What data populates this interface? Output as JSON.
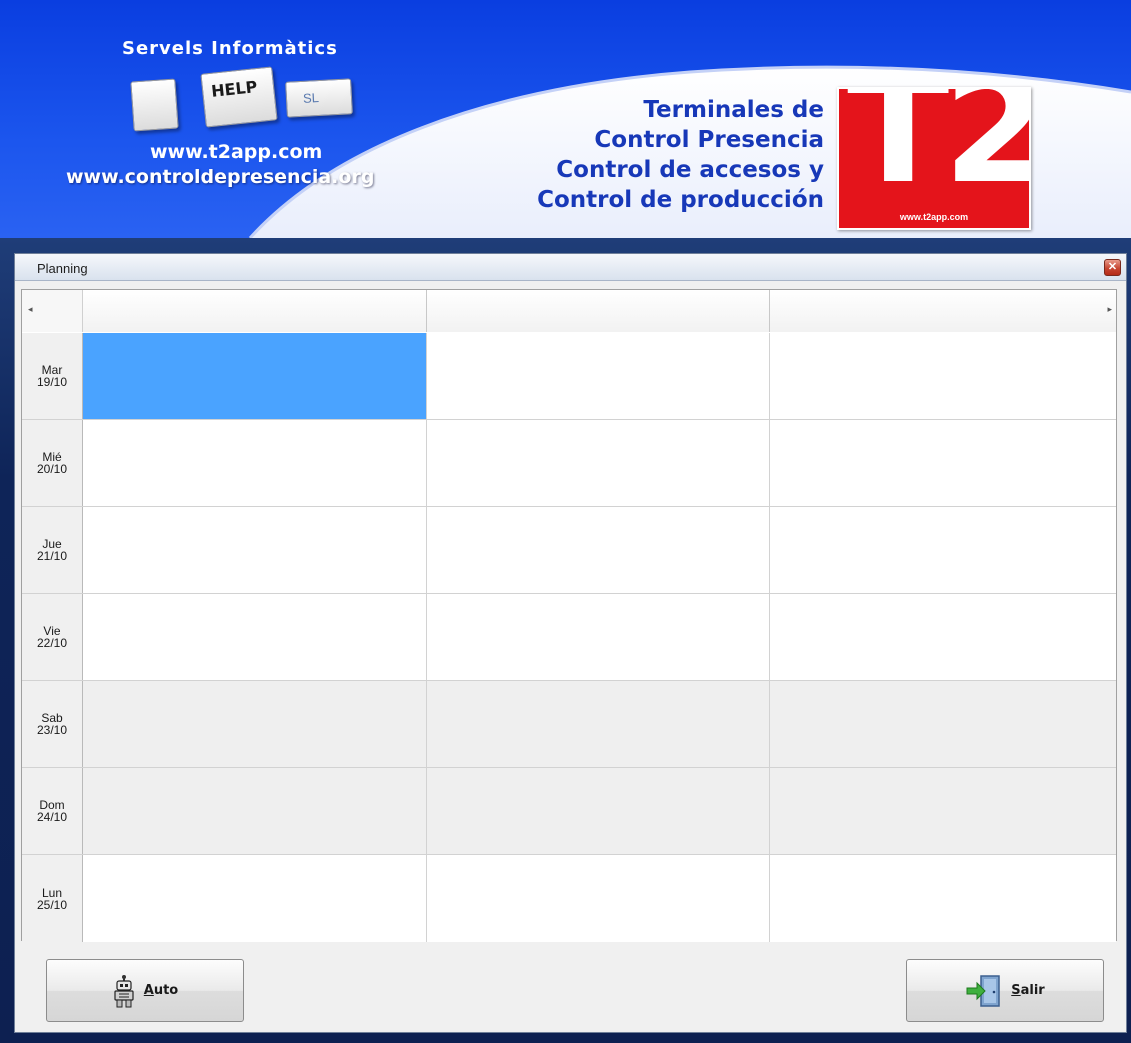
{
  "banner": {
    "brand_title": "Servels Informàtics",
    "key_help_text": "HELP",
    "key_sl_text": "SL",
    "url_primary": "www.t2app.com",
    "url_secondary": "www.controldepresencia.org",
    "tagline": [
      "Terminales de",
      "Control Presencia",
      "Control de accesos y",
      "Control de producción"
    ],
    "logo_text": "T2",
    "logo_url": "www.t2app.com",
    "colors": {
      "banner_blue": "#1c56ee",
      "tagline_blue": "#1738b8",
      "logo_red": "#e4141b"
    }
  },
  "window": {
    "title": "Planning",
    "close_icon": "close-icon"
  },
  "planning": {
    "columns": [
      "",
      "",
      ""
    ],
    "selected_cell": {
      "row": 0,
      "col": 0
    },
    "rows": [
      {
        "day": "Mar",
        "date": "19/10",
        "weekend": false
      },
      {
        "day": "Mié",
        "date": "20/10",
        "weekend": false
      },
      {
        "day": "Jue",
        "date": "21/10",
        "weekend": false
      },
      {
        "day": "Vie",
        "date": "22/10",
        "weekend": false
      },
      {
        "day": "Sab",
        "date": "23/10",
        "weekend": true
      },
      {
        "day": "Dom",
        "date": "24/10",
        "weekend": true
      },
      {
        "day": "Lun",
        "date": "25/10",
        "weekend": false
      }
    ],
    "colors": {
      "selected": "#4aa3ff",
      "weekend": "#efefef"
    }
  },
  "buttons": {
    "auto": {
      "mnemonic": "A",
      "rest": "uto",
      "icon": "robot-icon"
    },
    "salir": {
      "mnemonic": "S",
      "rest": "alir",
      "icon": "exit-door-icon"
    }
  }
}
